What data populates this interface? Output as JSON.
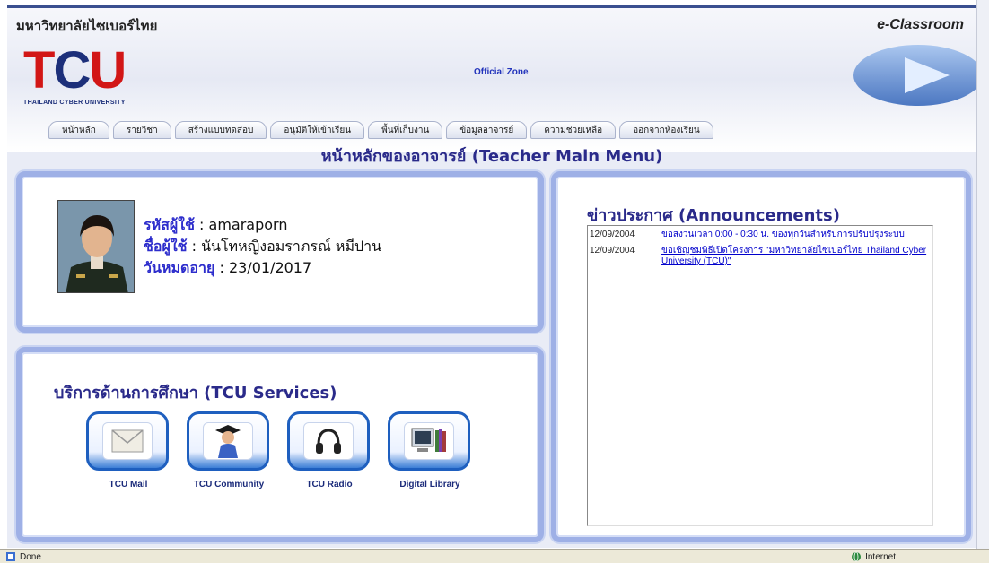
{
  "header": {
    "university_thai": "มหาวิทยาลัยไซเบอร์ไทย",
    "eclassroom": "e-Classroom",
    "logo_text": "TCU",
    "logo_sub": "THAILAND CYBER UNIVERSITY",
    "official_zone": "Official Zone"
  },
  "nav": {
    "tabs": [
      "หน้าหลัก",
      "รายวิชา",
      "สร้างแบบทดสอบ",
      "อนุมัติให้เข้าเรียน",
      "พื้นที่เก็บงาน",
      "ข้อมูลอาจารย์",
      "ความช่วยเหลือ",
      "ออกจากห้องเรียน"
    ]
  },
  "page_title": "หน้าหลักของอาจารย์ (Teacher Main Menu)",
  "user": {
    "id_label": "รหัสผู้ใช้",
    "id_value": ": amaraporn",
    "name_label": "ชื่อผู้ใช้",
    "name_value": ": นันโทหญิงอมราภรณ์   หมีปาน",
    "expiry_label": "วันหมดอายุ",
    "expiry_value": ": 23/01/2017"
  },
  "services": {
    "title": "บริการด้านการศึกษา (TCU Services)",
    "items": [
      {
        "label": "TCU Mail",
        "icon": "mail-icon"
      },
      {
        "label": "TCU Community",
        "icon": "community-icon"
      },
      {
        "label": "TCU Radio",
        "icon": "headphones-icon"
      },
      {
        "label": "Digital Library",
        "icon": "computer-icon"
      }
    ]
  },
  "news": {
    "title": "ข่าวประกาศ (Announcements)",
    "items": [
      {
        "date": "12/09/2004",
        "text": "ขอสงวนเวลา 0:00 - 0:30 น. ของทุกวันสำหรับการปรับปรุงระบบ"
      },
      {
        "date": "12/09/2004",
        "text": "ขอเชิญชมพิธีเปิดโครงการ \"มหาวิทยาลัยไซเบอร์ไทย Thailand Cyber University (TCU)\""
      }
    ]
  },
  "status": {
    "left": "Done",
    "zone": "Internet"
  },
  "colors": {
    "accent": "#2a2a8a",
    "panel_border": "#9eb0e6",
    "link": "#0000cc",
    "logo_red": "#d21616"
  }
}
